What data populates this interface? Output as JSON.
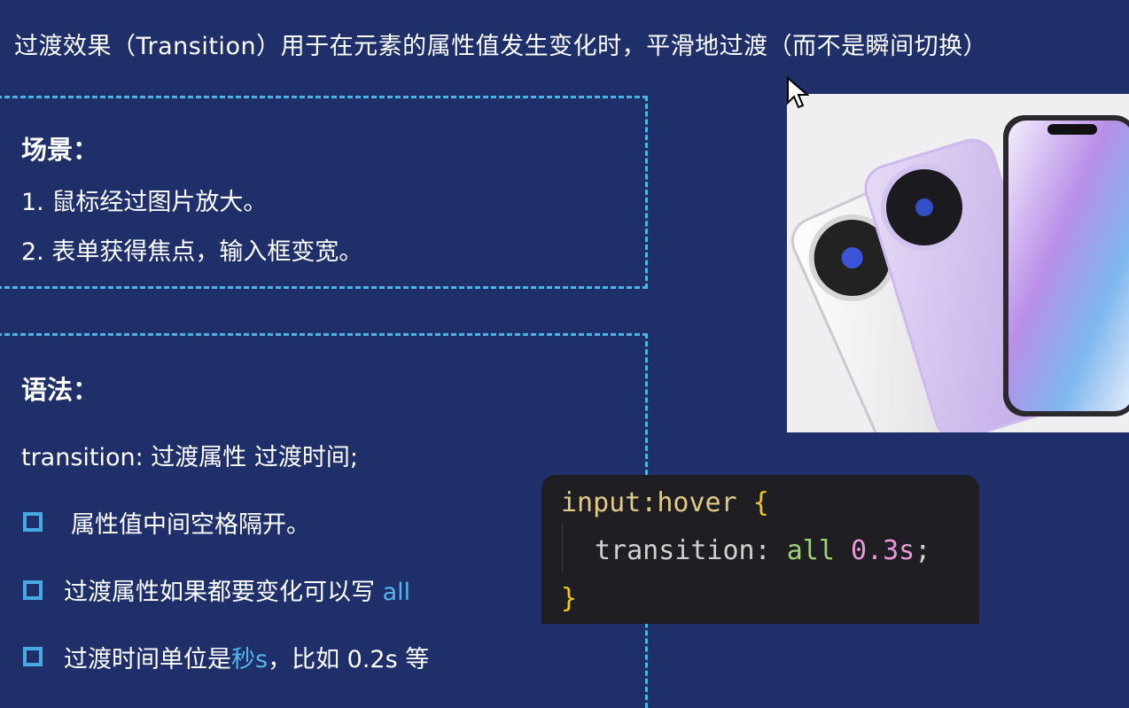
{
  "header": {
    "text": "过渡效果（Transition）用于在元素的属性值发生变化时，平滑地过渡（而不是瞬间切换）"
  },
  "scenarios": {
    "heading": "场景：",
    "items": [
      "1. 鼠标经过图片放大。",
      "2. 表单获得焦点，输入框变宽。"
    ]
  },
  "syntax": {
    "heading": "语法：",
    "definition": "transition: 过渡属性  过渡时间;",
    "bullets": [
      {
        "text": "属性值中间空格隔开。"
      },
      {
        "text": "过渡属性如果都要变化可以写 ",
        "highlight": "all"
      },
      {
        "prefix": "过渡时间单位是",
        "highlight": "秒s",
        "suffix": "，比如 0.2s  等"
      }
    ]
  },
  "code": {
    "line1_selector": "input:hover",
    "line1_brace": "{",
    "line2_property": "transition:",
    "line2_keyword": "all",
    "line2_value": "0.3s",
    "line2_semicolon": ";",
    "line3_brace": "}"
  },
  "image": {
    "icon": "phones-product-photo"
  },
  "colors": {
    "background": "#1e2f69",
    "accent": "#4fb3e6",
    "code_bg": "#1f1f23"
  }
}
